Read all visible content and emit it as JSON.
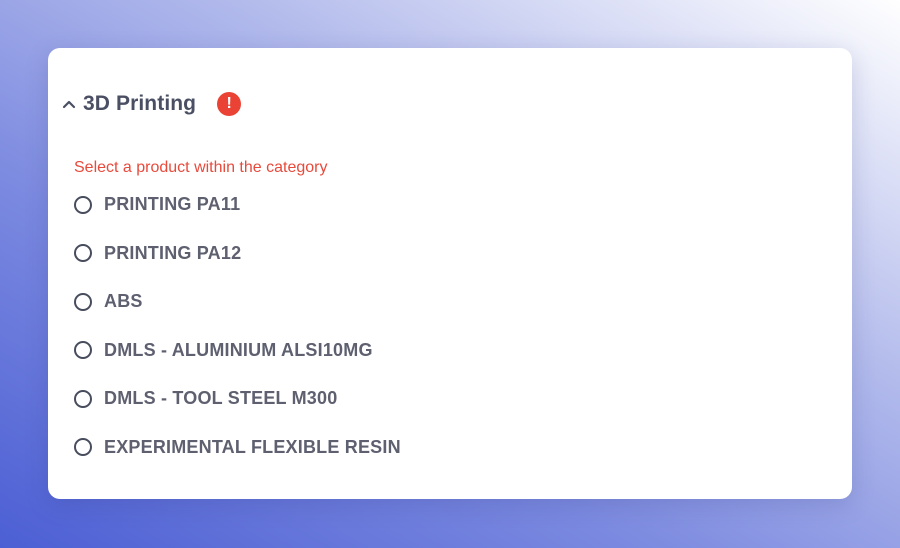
{
  "section": {
    "title": "3D Printing",
    "collapse_icon": "chevron-up-icon",
    "alert_icon": "exclamation-icon",
    "alert_symbol": "!",
    "error_message": "Select a product within the category"
  },
  "options": [
    {
      "label": "PRINTING PA11",
      "selected": false
    },
    {
      "label": "PRINTING PA12",
      "selected": false
    },
    {
      "label": "ABS",
      "selected": false
    },
    {
      "label": "DMLS - ALUMINIUM ALSI10MG",
      "selected": false
    },
    {
      "label": "DMLS - TOOL STEEL M300",
      "selected": false
    },
    {
      "label": "EXPERIMENTAL FLEXIBLE RESIN",
      "selected": false
    }
  ],
  "colors": {
    "error": "#e84a3c",
    "alert_badge": "#ea4335",
    "title": "#4a4f63",
    "option_text": "#5e6070"
  }
}
